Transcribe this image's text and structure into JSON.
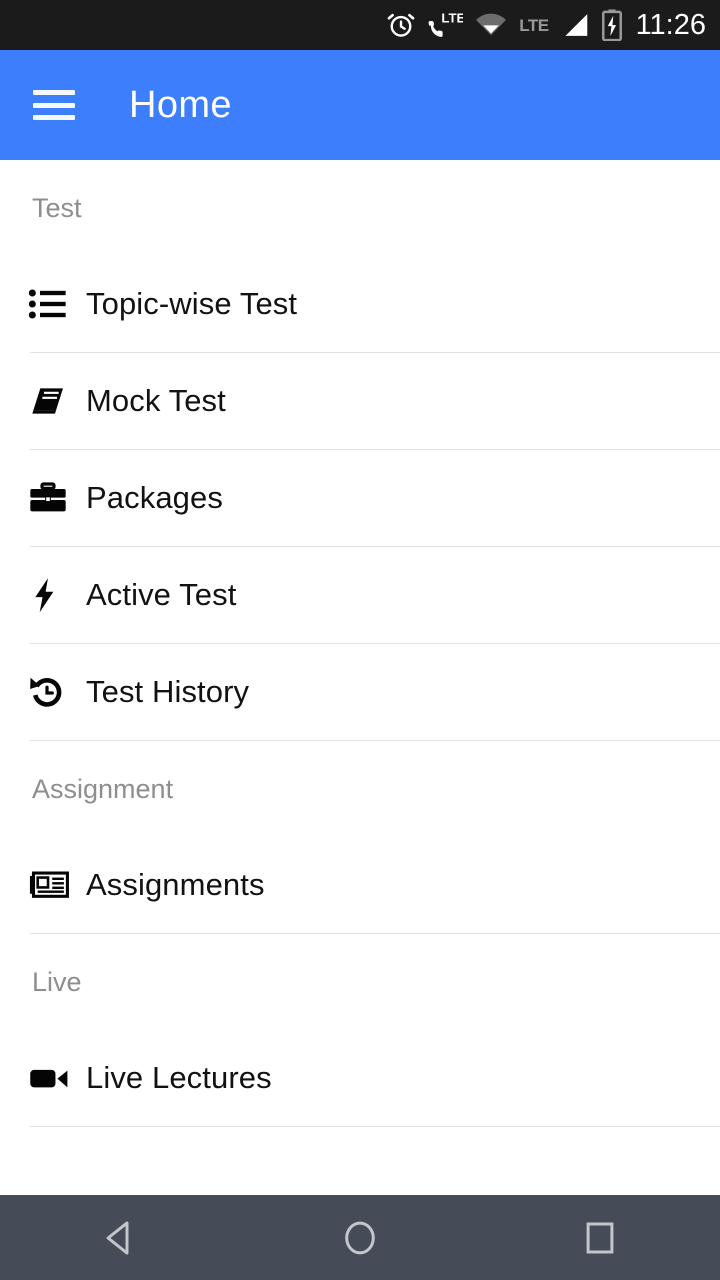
{
  "statusbar": {
    "time": "11:26",
    "lte_label": "LTE",
    "call_lte_label": "LTE",
    "icons": [
      "alarm-icon",
      "call-lte-icon",
      "wifi-icon",
      "lte-text",
      "signal-icon",
      "battery-charging-icon"
    ]
  },
  "appbar": {
    "title": "Home",
    "menu_icon": "hamburger-menu-icon",
    "background": "#3d7efd"
  },
  "sections": [
    {
      "header": "Test",
      "items": [
        {
          "label": "Topic-wise Test",
          "icon": "list-bullet-icon"
        },
        {
          "label": "Mock Test",
          "icon": "book-icon"
        },
        {
          "label": "Packages",
          "icon": "briefcase-icon"
        },
        {
          "label": "Active Test",
          "icon": "lightning-bolt-icon"
        },
        {
          "label": "Test History",
          "icon": "history-icon"
        }
      ]
    },
    {
      "header": "Assignment",
      "items": [
        {
          "label": "Assignments",
          "icon": "newspaper-icon"
        }
      ]
    },
    {
      "header": "Live",
      "items": [
        {
          "label": "Live Lectures",
          "icon": "video-camera-icon"
        }
      ]
    }
  ],
  "navbar": {
    "back_label": "Back",
    "home_label": "Home",
    "recents_label": "Recents",
    "background": "#454c57"
  },
  "colors": {
    "accent": "#3d7efd",
    "statusbar_bg": "#1b1b1b",
    "navbar_bg": "#454c57",
    "divider": "#e2e2e2",
    "section_text": "#8e8e8e",
    "item_text": "#121212"
  }
}
